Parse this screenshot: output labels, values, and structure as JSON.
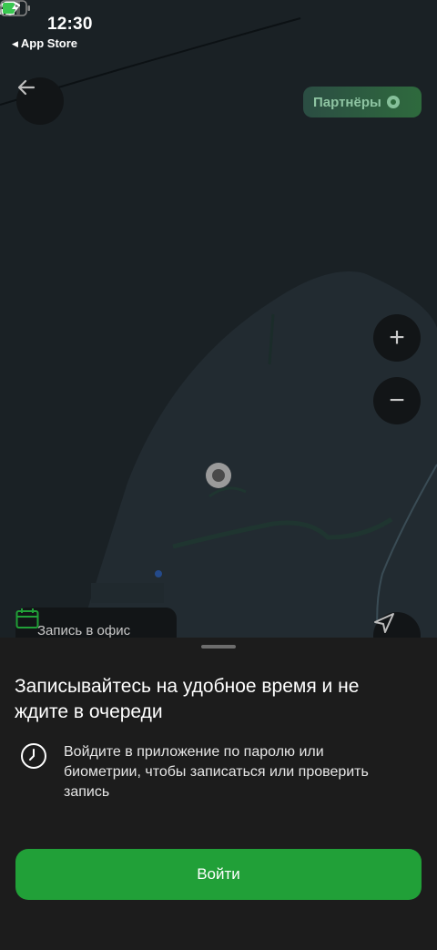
{
  "status_bar": {
    "time": "12:30",
    "back_app_label": "App Store"
  },
  "map": {
    "partners_label": "Партнёры",
    "office_chip_label": "Запись в офис",
    "zoom_in_symbol": "+",
    "zoom_out_symbol": "−"
  },
  "sheet": {
    "title": "Записывайтесь на удобное время и не ждите в очереди",
    "info_text": "Войдите в приложение по паролю или биометрии, чтобы записаться или проверить запись",
    "login_button_label": "Войти"
  },
  "colors": {
    "accent_green": "#21a038",
    "sheet_background": "#1c1c1c",
    "map_background": "#1a2125"
  }
}
